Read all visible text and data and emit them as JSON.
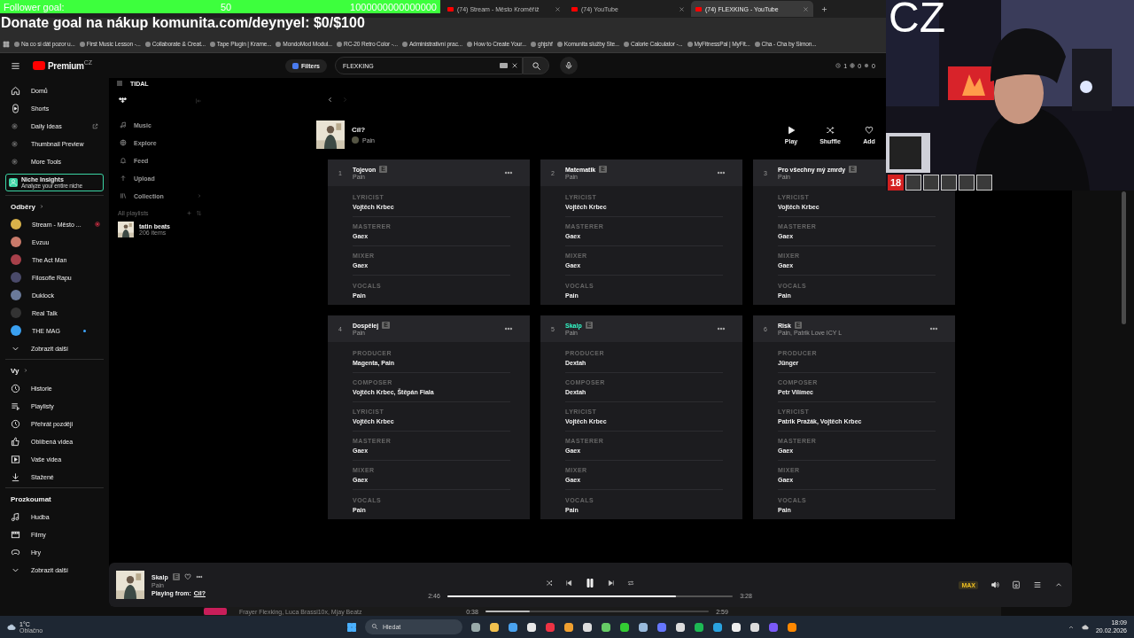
{
  "overlay": {
    "follower_goal": {
      "label": "Follower goal:",
      "current": "50",
      "target": "1000000000000000"
    },
    "donate_goal": "Donate goal na nákup komunita.com/deynyel: $0/$100",
    "webcam": {
      "kind": "picture",
      "caption": "CZ",
      "badge": "18"
    }
  },
  "browser": {
    "tabs": [
      {
        "title": "(74) Stream - Město Kroměříž",
        "selected": false
      },
      {
        "title": "(74) YouTube",
        "selected": false
      },
      {
        "title": "(74) FLEXKING - YouTube",
        "selected": true
      }
    ],
    "bookmarks": [
      "Na co si dát pozor u...",
      "First Music Lesson -...",
      "Collaborate & Creat...",
      "Tape Plugin | Krame...",
      "MondoMod Modul...",
      "RC-20 Retro Color -...",
      "Administrativní prac...",
      "How to Create Your...",
      "ghjshf",
      "Komunita služby Ste...",
      "Calorie Calculator -...",
      "MyFitnessPal | MyFit...",
      "Cha - Cha by Simon..."
    ]
  },
  "youtube": {
    "logo": "Premium",
    "region": "CZ",
    "filters": "Filters",
    "search": {
      "value": "FLEXKING"
    },
    "counters": [
      "1",
      "0",
      "0"
    ],
    "sidebar": {
      "main": [
        {
          "label": "Domů"
        },
        {
          "label": "Shorts"
        },
        {
          "label": "Daily Ideas"
        },
        {
          "label": "Thumbnail Preview"
        },
        {
          "label": "More Tools"
        }
      ],
      "promo": {
        "title": "Niche Insights",
        "subtitle": "Analyze your entire niche"
      },
      "subscriptions": {
        "title": "Odběry",
        "channels": [
          {
            "label": "Stream - Město ...",
            "live": true,
            "new": false
          },
          {
            "label": "Evzuu",
            "live": false,
            "new": false
          },
          {
            "label": "The Act Man",
            "live": false,
            "new": false
          },
          {
            "label": "Filosofie Rapu",
            "live": false,
            "new": false
          },
          {
            "label": "Duklock",
            "live": false,
            "new": false
          },
          {
            "label": "Real Talk",
            "live": false,
            "new": false
          },
          {
            "label": "THE MAG",
            "live": false,
            "new": true
          }
        ],
        "more": "Zobrazit další"
      },
      "you": {
        "title": "Vy",
        "items": [
          "Historie",
          "Playlisty",
          "Přehrát později",
          "Oblíbená videa",
          "Vaše videa",
          "Stažené"
        ]
      },
      "explore": {
        "title": "Prozkoumat",
        "items": [
          "Hudba",
          "Filmy",
          "Hry"
        ],
        "more": "Zobrazit další"
      }
    }
  },
  "tidal": {
    "title": "TIDAL",
    "nav": [
      "Music",
      "Explore",
      "Feed",
      "Upload",
      "Collection"
    ],
    "playlists_label": "All playlists",
    "playlists": [
      {
        "name": "tatin beats",
        "count": "206 items"
      }
    ],
    "album": {
      "title": "Cíl?",
      "artist": "Pain",
      "actions": [
        "Play",
        "Shuffle",
        "Add"
      ]
    },
    "tracks": [
      {
        "number": "1",
        "title": "Tojevon",
        "badge": "E",
        "artists": "Pain",
        "playing": false,
        "credits": [
          {
            "role": "LYRICIST",
            "names": "Vojtěch Krbec"
          },
          {
            "role": "MASTERER",
            "names": "Gaex"
          },
          {
            "role": "MIXER",
            "names": "Gaex"
          },
          {
            "role": "VOCALS",
            "names": "Pain"
          }
        ]
      },
      {
        "number": "2",
        "title": "Matematik",
        "badge": "E",
        "artists": "Pain",
        "playing": false,
        "credits": [
          {
            "role": "LYRICIST",
            "names": "Vojtěch Krbec"
          },
          {
            "role": "MASTERER",
            "names": "Gaex"
          },
          {
            "role": "MIXER",
            "names": "Gaex"
          },
          {
            "role": "VOCALS",
            "names": "Pain"
          }
        ]
      },
      {
        "number": "3",
        "title": "Pro všechny mý zmrdy",
        "badge": "E",
        "artists": "Pain",
        "playing": false,
        "credits": [
          {
            "role": "LYRICIST",
            "names": "Vojtěch Krbec"
          },
          {
            "role": "MASTERER",
            "names": "Gaex"
          },
          {
            "role": "MIXER",
            "names": "Gaex"
          },
          {
            "role": "VOCALS",
            "names": "Pain"
          }
        ]
      },
      {
        "number": "4",
        "title": "Dospělej",
        "badge": "E",
        "artists": "Pain",
        "playing": false,
        "credits": [
          {
            "role": "PRODUCER",
            "names": "Magenta, Pain"
          },
          {
            "role": "COMPOSER",
            "names": "Vojtěch Krbec, Štěpán Fiala"
          },
          {
            "role": "LYRICIST",
            "names": "Vojtěch Krbec"
          },
          {
            "role": "MASTERER",
            "names": "Gaex"
          },
          {
            "role": "MIXER",
            "names": "Gaex"
          },
          {
            "role": "VOCALS",
            "names": "Pain"
          }
        ]
      },
      {
        "number": "5",
        "title": "Skalp",
        "badge": "E",
        "artists": "Pain",
        "playing": true,
        "credits": [
          {
            "role": "PRODUCER",
            "names": "Dextah"
          },
          {
            "role": "COMPOSER",
            "names": "Dextah"
          },
          {
            "role": "LYRICIST",
            "names": "Vojtěch Krbec"
          },
          {
            "role": "MASTERER",
            "names": "Gaex"
          },
          {
            "role": "MIXER",
            "names": "Gaex"
          },
          {
            "role": "VOCALS",
            "names": "Pain"
          }
        ]
      },
      {
        "number": "6",
        "title": "Risk",
        "badge": "E",
        "artists": "Pain, Patrik Love ICY L",
        "playing": false,
        "credits": [
          {
            "role": "PRODUCER",
            "names": "Jünger"
          },
          {
            "role": "COMPOSER",
            "names": "Petr Vilímec"
          },
          {
            "role": "LYRICIST",
            "names": "Patrik Pražák, Vojtěch Krbec"
          },
          {
            "role": "MASTERER",
            "names": "Gaex"
          },
          {
            "role": "MIXER",
            "names": "Gaex"
          },
          {
            "role": "VOCALS",
            "names": "Pain"
          }
        ]
      }
    ],
    "player": {
      "title": "Skalp",
      "badge": "E",
      "artist": "Pain",
      "source_label": "Playing from:",
      "source": "Cíl?",
      "elapsed": "2:46",
      "total": "3:28",
      "level": 0.8,
      "quality": "MAX"
    },
    "background_player": {
      "artists": "Frayer Flexking, Luca Brassi10x, Mjay Beatz",
      "elapsed": "0:38",
      "total": "2:59",
      "level": 0.2
    }
  },
  "taskbar": {
    "weather": {
      "temperature": "1°C",
      "condition": "Oblačno"
    },
    "search": {
      "placeholder": "Hledat"
    },
    "time": "18:09",
    "date": "20.02.2026"
  }
}
